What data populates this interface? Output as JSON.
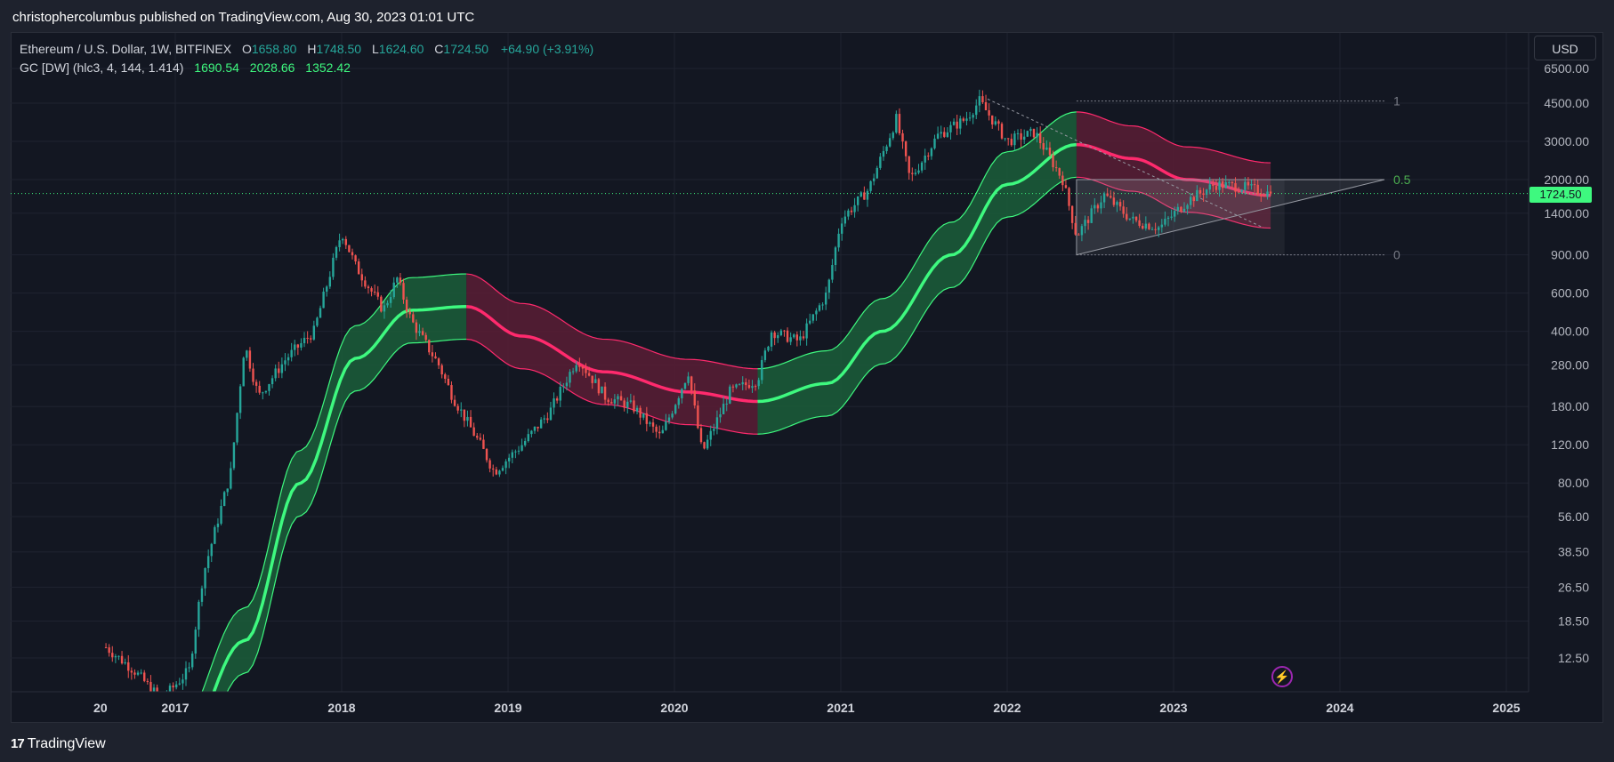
{
  "header": {
    "published_line": "christophercolumbus published on TradingView.com, Aug 30, 2023 01:01 UTC"
  },
  "legend": {
    "symbol": "Ethereum / U.S. Dollar, 1W, BITFINEX",
    "open_label": "O",
    "open": "1658.80",
    "high_label": "H",
    "high": "1748.50",
    "low_label": "L",
    "low": "1624.60",
    "close_label": "C",
    "close": "1724.50",
    "change": "+64.90 (+3.91%)",
    "indicator": "GC [DW] (hlc3, 4, 144, 1.414)",
    "ind_mid": "1690.54",
    "ind_upper": "2028.66",
    "ind_lower": "1352.42"
  },
  "currency_button": "USD",
  "last_price_tag": "1724.50",
  "footer": {
    "brand": "TradingView",
    "logo": "17"
  },
  "icons": {
    "flash": "lightning-icon"
  },
  "colors": {
    "up_candle": "#26a69a",
    "down_candle": "#ef5350",
    "channel_green": "#3ef97f",
    "channel_red": "#ff2a6d",
    "fill_green": "#1b5e3a",
    "fill_red": "#5a1d35",
    "background": "#131722"
  },
  "chart_data": {
    "type": "candlestick",
    "title": "Ethereum / U.S. Dollar, 1W, BITFINEX",
    "y_scale": "log",
    "y_ticks": [
      "6500.00",
      "4500.00",
      "3000.00",
      "2000.00",
      "1400.00",
      "900.00",
      "600.00",
      "400.00",
      "280.00",
      "180.00",
      "120.00",
      "80.00",
      "56.00",
      "38.50",
      "26.50",
      "18.50",
      "12.50"
    ],
    "x_ticks": [
      "20",
      "2017",
      "2018",
      "2019",
      "2020",
      "2021",
      "2022",
      "2023",
      "2024",
      "2025"
    ],
    "last_price": 1724.5,
    "price_path": [
      [
        "2016-08",
        14
      ],
      [
        "2016-10",
        11
      ],
      [
        "2016-12",
        8
      ],
      [
        "2017-02",
        11
      ],
      [
        "2017-03",
        30
      ],
      [
        "2017-05",
        90
      ],
      [
        "2017-06",
        350
      ],
      [
        "2017-07",
        200
      ],
      [
        "2017-09",
        300
      ],
      [
        "2017-11",
        400
      ],
      [
        "2018-01",
        1150
      ],
      [
        "2018-02",
        800
      ],
      [
        "2018-04",
        500
      ],
      [
        "2018-05",
        700
      ],
      [
        "2018-06",
        450
      ],
      [
        "2018-08",
        280
      ],
      [
        "2018-09",
        200
      ],
      [
        "2018-11",
        120
      ],
      [
        "2018-12",
        90
      ],
      [
        "2019-02",
        120
      ],
      [
        "2019-04",
        170
      ],
      [
        "2019-06",
        300
      ],
      [
        "2019-08",
        200
      ],
      [
        "2019-10",
        180
      ],
      [
        "2019-12",
        130
      ],
      [
        "2020-02",
        260
      ],
      [
        "2020-03",
        110
      ],
      [
        "2020-05",
        210
      ],
      [
        "2020-07",
        240
      ],
      [
        "2020-08",
        400
      ],
      [
        "2020-10",
        360
      ],
      [
        "2020-12",
        600
      ],
      [
        "2021-01",
        1300
      ],
      [
        "2021-03",
        1800
      ],
      [
        "2021-05",
        3800
      ],
      [
        "2021-06",
        2000
      ],
      [
        "2021-08",
        3200
      ],
      [
        "2021-10",
        3800
      ],
      [
        "2021-11",
        4600
      ],
      [
        "2022-01",
        3000
      ],
      [
        "2022-03",
        3300
      ],
      [
        "2022-05",
        2000
      ],
      [
        "2022-06",
        1100
      ],
      [
        "2022-08",
        1700
      ],
      [
        "2022-10",
        1300
      ],
      [
        "2022-12",
        1200
      ],
      [
        "2023-02",
        1600
      ],
      [
        "2023-04",
        1900
      ],
      [
        "2023-06",
        1850
      ],
      [
        "2023-08",
        1724.5
      ]
    ],
    "gc_channel": {
      "name": "GC [DW] (hlc3, 4, 144, 1.414)",
      "mid": [
        [
          "2017-01",
          4
        ],
        [
          "2017-06",
          15
        ],
        [
          "2017-10",
          80
        ],
        [
          "2018-02",
          300
        ],
        [
          "2018-06",
          500
        ],
        [
          "2018-10",
          520
        ],
        [
          "2019-02",
          380
        ],
        [
          "2019-08",
          260
        ],
        [
          "2020-02",
          210
        ],
        [
          "2020-07",
          190
        ],
        [
          "2020-12",
          230
        ],
        [
          "2021-04",
          400
        ],
        [
          "2021-09",
          900
        ],
        [
          "2022-01",
          1900
        ],
        [
          "2022-06",
          2900
        ],
        [
          "2022-10",
          2500
        ],
        [
          "2023-02",
          2000
        ],
        [
          "2023-08",
          1690.54
        ]
      ],
      "width_factor": 1.414,
      "last_upper": 2028.66,
      "last_lower": 1352.42,
      "turn_red": [
        "2018-10",
        "2022-06"
      ],
      "turn_green": [
        "2020-07"
      ]
    },
    "fib_levels": [
      {
        "label": "1",
        "price": 4600
      },
      {
        "label": "0.5",
        "price": 2000
      },
      {
        "label": "0",
        "price": 900
      }
    ],
    "fib_range": [
      "2022-06",
      "2023-09"
    ]
  }
}
